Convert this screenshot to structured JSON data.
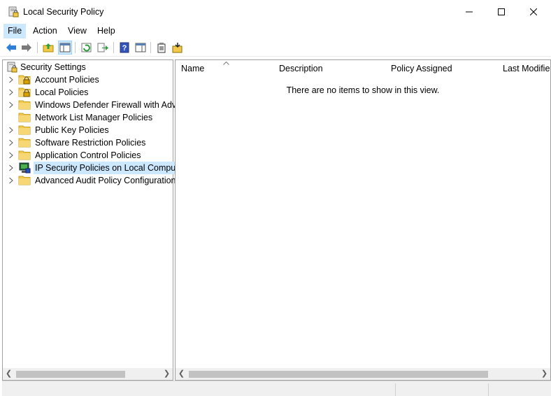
{
  "window": {
    "title": "Local Security Policy",
    "minimize": "minimize",
    "maximize": "maximize",
    "close": "close"
  },
  "menu": [
    "File",
    "Action",
    "View",
    "Help"
  ],
  "toolbar": {
    "buttons": [
      "back-arrow-icon",
      "forward-arrow-icon",
      "up-folder-icon",
      "show-hide-tree-icon",
      "refresh-icon",
      "export-list-icon",
      "help-icon",
      "action-pane-icon",
      "properties-icon",
      "import-policy-icon"
    ]
  },
  "tree": {
    "root": "Security Settings",
    "items": [
      {
        "label": "Account Policies",
        "icon": "folder-lock-icon",
        "expandable": true
      },
      {
        "label": "Local Policies",
        "icon": "folder-lock-icon",
        "expandable": true
      },
      {
        "label": "Windows Defender Firewall with Adva",
        "icon": "folder-icon",
        "expandable": true
      },
      {
        "label": "Network List Manager Policies",
        "icon": "folder-icon",
        "expandable": false
      },
      {
        "label": "Public Key Policies",
        "icon": "folder-icon",
        "expandable": true
      },
      {
        "label": "Software Restriction Policies",
        "icon": "folder-icon",
        "expandable": true
      },
      {
        "label": "Application Control Policies",
        "icon": "folder-icon",
        "expandable": true
      },
      {
        "label": "IP Security Policies on Local Compute",
        "icon": "ip-security-icon",
        "expandable": true,
        "selected": true
      },
      {
        "label": "Advanced Audit Policy Configuration",
        "icon": "folder-icon",
        "expandable": true
      }
    ]
  },
  "list": {
    "columns": [
      "Name",
      "Description",
      "Policy Assigned",
      "Last Modified"
    ],
    "empty_message": "There are no items to show in this view."
  },
  "colors": {
    "selection": "#cce8ff",
    "folder": "#f2c94c",
    "border": "#a0a0a0"
  }
}
